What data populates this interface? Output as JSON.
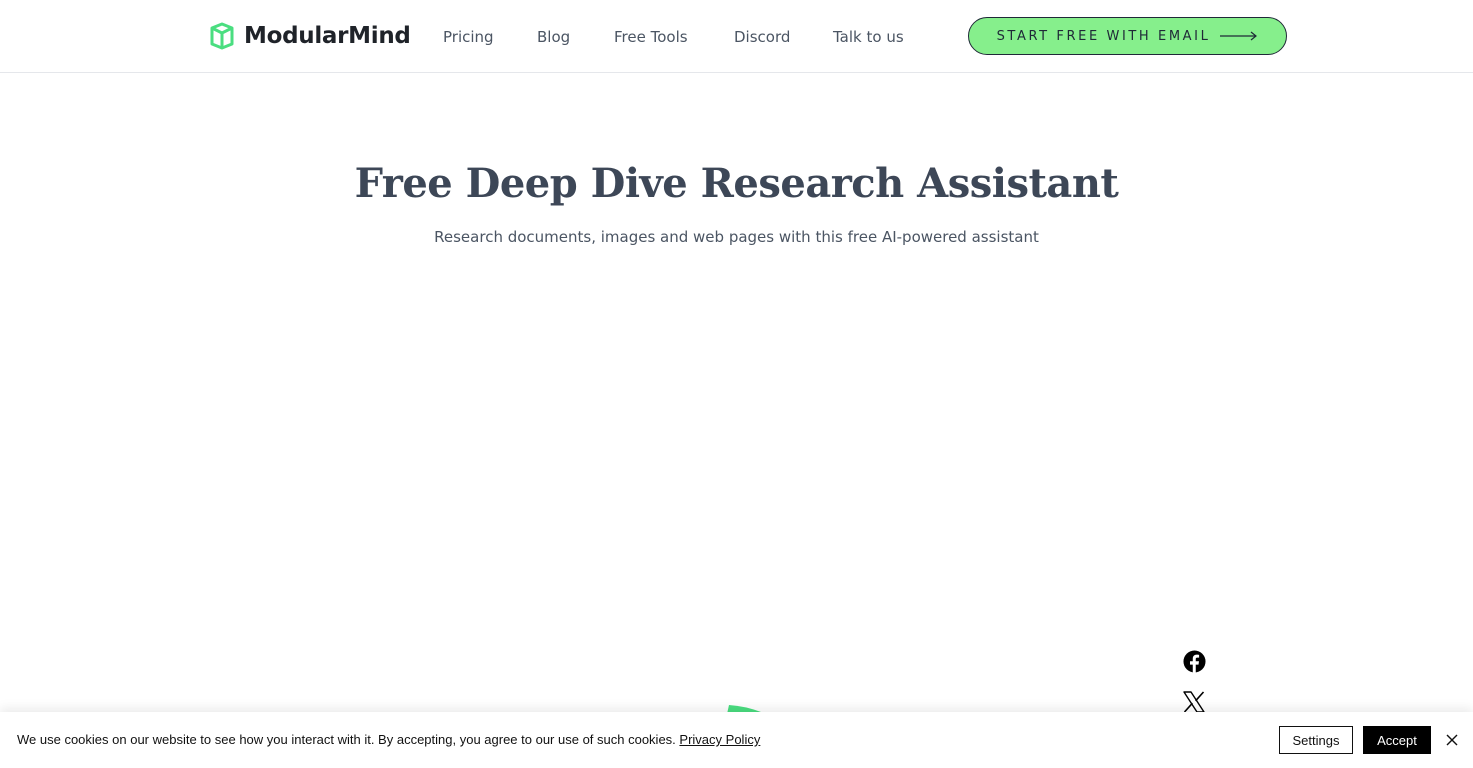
{
  "header": {
    "brand": "ModularMind",
    "nav": [
      "Pricing",
      "Blog",
      "Free Tools",
      "Discord",
      "Talk to us"
    ],
    "cta_label": "START FREE WITH EMAIL"
  },
  "hero": {
    "title": "Free Deep Dive Research Assistant",
    "subtitle": "Research documents, images and web pages with this free AI-powered assistant"
  },
  "social_icons": [
    "facebook-icon",
    "x-icon"
  ],
  "cookie_banner": {
    "text": "We use cookies on our website to see how you interact with it. By accepting, you agree to our use of such cookies.",
    "link_label": "Privacy Policy",
    "settings_label": "Settings",
    "accept_label": "Accept"
  },
  "colors": {
    "accent": "#86ef8c",
    "logo_green": "#4ade80",
    "heading": "#3d4757",
    "text": "#4b5563"
  }
}
